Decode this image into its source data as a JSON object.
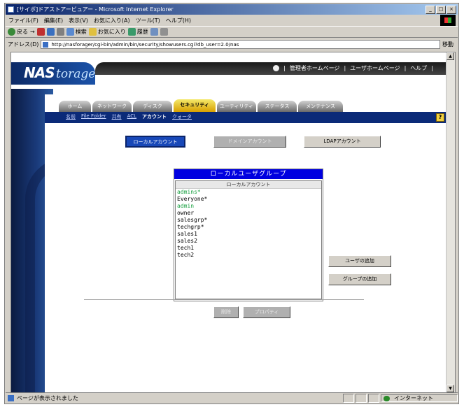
{
  "window": {
    "title": "[サイボ]ドアストアービュアー - Microsoft Internet Explorer",
    "controls": [
      "_",
      "□",
      "×"
    ]
  },
  "menubar": [
    "ファイル(F)",
    "編集(E)",
    "表示(V)",
    "お気に入り(A)",
    "ツール(T)",
    "ヘルプ(H)"
  ],
  "toolbar": {
    "back": "戻る",
    "forward": "→",
    "search": "検索",
    "favorites": "お気に入り",
    "history": "履歴"
  },
  "addressbar": {
    "label": "アドレス(D)",
    "url": "http://nasforager/cgi-bin/admin/bin/security/showusers.cgi?db_user=2.0/nas",
    "go": "移動"
  },
  "header": {
    "logo_nas": "NAS",
    "logo_storage": "torage",
    "links": [
      "|",
      "管理者ホームページ",
      "|",
      "ユーザホームページ",
      "|",
      "ヘルプ",
      "|"
    ]
  },
  "tabs": [
    "ホーム",
    "ネットワーク",
    "ディスク",
    "セキュリティ",
    "ユーティリティ",
    "ステータス",
    "メンテナンス"
  ],
  "subnav": [
    "名前",
    "File Folder",
    "共有",
    "ACL",
    "アカウント",
    "クォータ"
  ],
  "account_buttons": {
    "local": "ローカルアカウント",
    "domain": "ドメインアカウント",
    "ldap": "LDAPアカウント"
  },
  "userlist": {
    "title": "ローカルユーザグループ",
    "list_header": "ローカルアカウント",
    "accounts": [
      "admins*",
      "Everyone*",
      "admin",
      "owner",
      "salesgrp*",
      "techgrp*",
      "sales1",
      "sales2",
      "tech1",
      "tech2"
    ],
    "highlighted": [
      "admins*",
      "admin"
    ]
  },
  "side_buttons": {
    "add_user": "ユーザの追加",
    "add_group": "グループの追加"
  },
  "bottom_buttons": {
    "delete": "削除",
    "properties": "プロパティ"
  },
  "statusbar": {
    "message": "ページが表示されました",
    "zone": "インターネット"
  },
  "colors": {
    "title_start": "#0a246a",
    "header_blue": "#0000e0",
    "active_tab": "#f4e96a",
    "nav_bg": "#0b2a78",
    "highlight_text": "#18a040"
  }
}
